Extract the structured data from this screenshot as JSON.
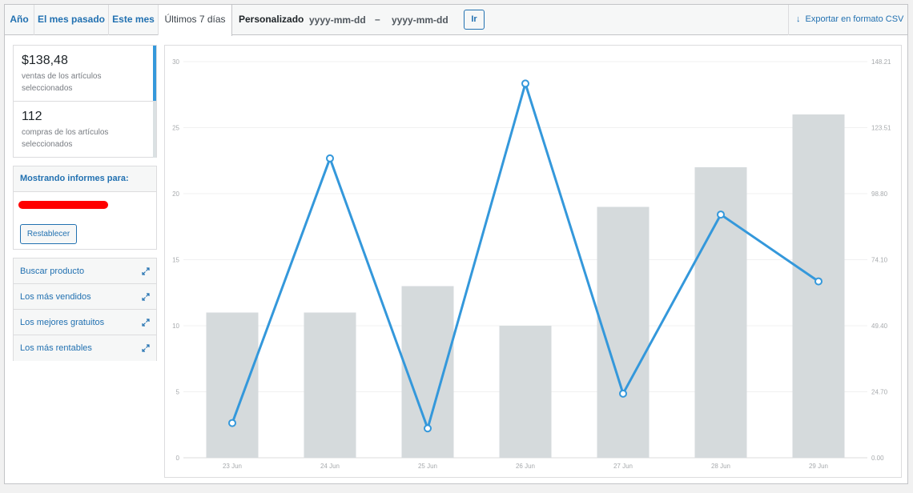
{
  "tabs": [
    {
      "label": "Año"
    },
    {
      "label": "El mes pasado"
    },
    {
      "label": "Este mes"
    },
    {
      "label": "Últimos 7 días"
    }
  ],
  "active_tab": 3,
  "custom_range": {
    "label": "Personalizado",
    "start_placeholder": "yyyy-mm-dd",
    "separator": "–",
    "end_placeholder": "yyyy-mm-dd",
    "go_label": "Ir"
  },
  "export": {
    "label": "Exportar en formato CSV",
    "icon": "download-arrow-icon"
  },
  "summary": [
    {
      "value": "$138,48",
      "desc": "ventas de los artículos seleccionados",
      "color": "#3498db"
    },
    {
      "value": "112",
      "desc": "compras de los artículos seleccionados",
      "color": "#dbe1e3"
    }
  ],
  "filter": {
    "header": "Mostrando informes para:",
    "reset_label": "Restablecer"
  },
  "widgets": [
    {
      "label": "Buscar producto",
      "icon": "expand-icon"
    },
    {
      "label": "Los más vendidos",
      "icon": "expand-icon"
    },
    {
      "label": "Los mejores gratuitos",
      "icon": "expand-icon"
    },
    {
      "label": "Los más rentables",
      "icon": "expand-icon"
    }
  ],
  "colors": {
    "link": "#2271b1",
    "bars": "#d5dadc",
    "line": "#3498db"
  },
  "chart_data": {
    "type": "bar",
    "categories": [
      "23 Jun",
      "24 Jun",
      "25 Jun",
      "26 Jun",
      "27 Jun",
      "28 Jun",
      "29 Jun"
    ],
    "series": [
      {
        "type": "bar",
        "axis": "left",
        "values": [
          11,
          11,
          13,
          10,
          19,
          22,
          26
        ]
      },
      {
        "type": "line",
        "axis": "right",
        "values": [
          13.0,
          112.0,
          11.0,
          140.0,
          24.0,
          91.0,
          66.0
        ]
      }
    ],
    "y_left": {
      "ylim": [
        0,
        30
      ],
      "ticks": [
        "0",
        "5",
        "10",
        "15",
        "20",
        "25",
        "30"
      ]
    },
    "y_right": {
      "ylim": [
        0,
        148.21
      ],
      "ticks": [
        "0.00",
        "24.70",
        "49.40",
        "74.10",
        "98.80",
        "123.51",
        "148.21"
      ]
    },
    "grid": true
  }
}
